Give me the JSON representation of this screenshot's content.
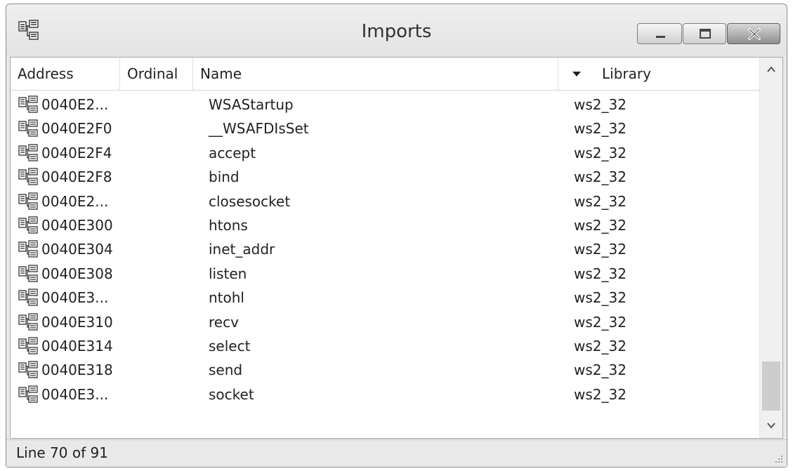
{
  "window": {
    "title": "Imports",
    "icon": "imports-tree-icon",
    "controls": [
      "minimize-icon",
      "maximize-icon",
      "close-icon"
    ]
  },
  "columns": {
    "address": "Address",
    "ordinal": "Ordinal",
    "name": "Name",
    "library": "Library",
    "sorted_by": "Library"
  },
  "rows": [
    {
      "address": "0040E2...",
      "ordinal": "",
      "name": "WSAStartup",
      "library": "ws2_32"
    },
    {
      "address": "0040E2F0",
      "ordinal": "",
      "name": "__WSAFDIsSet",
      "library": "ws2_32"
    },
    {
      "address": "0040E2F4",
      "ordinal": "",
      "name": "accept",
      "library": "ws2_32"
    },
    {
      "address": "0040E2F8",
      "ordinal": "",
      "name": "bind",
      "library": "ws2_32"
    },
    {
      "address": "0040E2...",
      "ordinal": "",
      "name": "closesocket",
      "library": "ws2_32"
    },
    {
      "address": "0040E300",
      "ordinal": "",
      "name": "htons",
      "library": "ws2_32"
    },
    {
      "address": "0040E304",
      "ordinal": "",
      "name": "inet_addr",
      "library": "ws2_32"
    },
    {
      "address": "0040E308",
      "ordinal": "",
      "name": "listen",
      "library": "ws2_32"
    },
    {
      "address": "0040E3...",
      "ordinal": "",
      "name": "ntohl",
      "library": "ws2_32"
    },
    {
      "address": "0040E310",
      "ordinal": "",
      "name": "recv",
      "library": "ws2_32"
    },
    {
      "address": "0040E314",
      "ordinal": "",
      "name": "select",
      "library": "ws2_32"
    },
    {
      "address": "0040E318",
      "ordinal": "",
      "name": "send",
      "library": "ws2_32"
    },
    {
      "address": "0040E3...",
      "ordinal": "",
      "name": "socket",
      "library": "ws2_32"
    }
  ],
  "status": {
    "text": "Line 70 of 91"
  },
  "scroll": {
    "line": 70,
    "total": 91
  }
}
